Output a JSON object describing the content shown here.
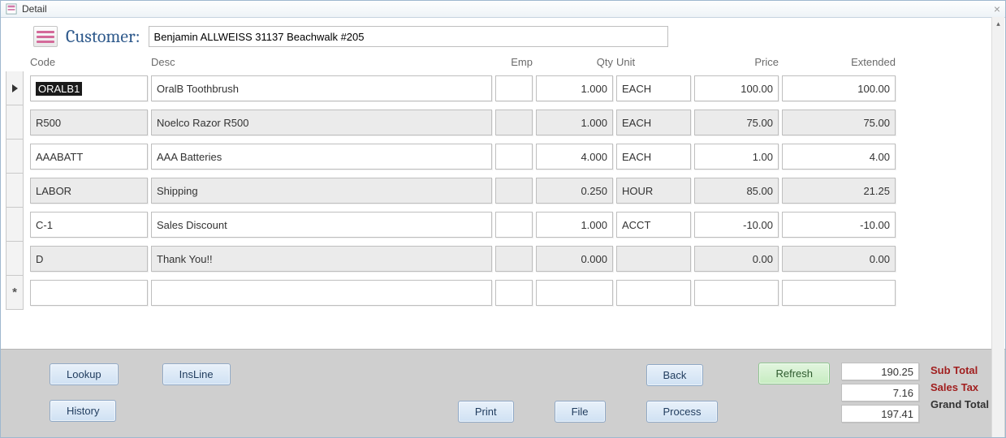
{
  "title": "Detail",
  "header": {
    "customer_label": "Customer:",
    "customer_value": "Benjamin ALLWEISS 31137 Beachwalk #205"
  },
  "columns": {
    "code": "Code",
    "desc": "Desc",
    "emp": "Emp",
    "qty": "Qty",
    "unit": "Unit",
    "price": "Price",
    "ext": "Extended"
  },
  "rows": [
    {
      "code": "ORALB1",
      "desc": "OralB Toothbrush",
      "emp": "",
      "qty": "1.000",
      "unit": "EACH",
      "price": "100.00",
      "ext": "100.00",
      "selected": true
    },
    {
      "code": "R500",
      "desc": "Noelco Razor R500",
      "emp": "",
      "qty": "1.000",
      "unit": "EACH",
      "price": "75.00",
      "ext": "75.00"
    },
    {
      "code": "AAABATT",
      "desc": "AAA Batteries",
      "emp": "",
      "qty": "4.000",
      "unit": "EACH",
      "price": "1.00",
      "ext": "4.00"
    },
    {
      "code": "LABOR",
      "desc": "Shipping",
      "emp": "",
      "qty": "0.250",
      "unit": "HOUR",
      "price": "85.00",
      "ext": "21.25"
    },
    {
      "code": "C-1",
      "desc": "Sales Discount",
      "emp": "",
      "qty": "1.000",
      "unit": "ACCT",
      "price": "-10.00",
      "ext": "-10.00"
    },
    {
      "code": "D",
      "desc": "Thank You!!",
      "emp": "",
      "qty": "0.000",
      "unit": "",
      "price": "0.00",
      "ext": "0.00"
    },
    {
      "code": "",
      "desc": "",
      "emp": "",
      "qty": "",
      "unit": "",
      "price": "",
      "ext": "",
      "new": true
    }
  ],
  "buttons": {
    "lookup": "Lookup",
    "insline": "InsLine",
    "history": "History",
    "print": "Print",
    "file": "File",
    "process": "Process",
    "back": "Back",
    "refresh": "Refresh"
  },
  "totals": {
    "subtotal_label": "Sub Total",
    "subtotal": "190.25",
    "tax_label": "Sales Tax",
    "tax": "7.16",
    "grand_label": "Grand Total",
    "grand": "197.41"
  }
}
